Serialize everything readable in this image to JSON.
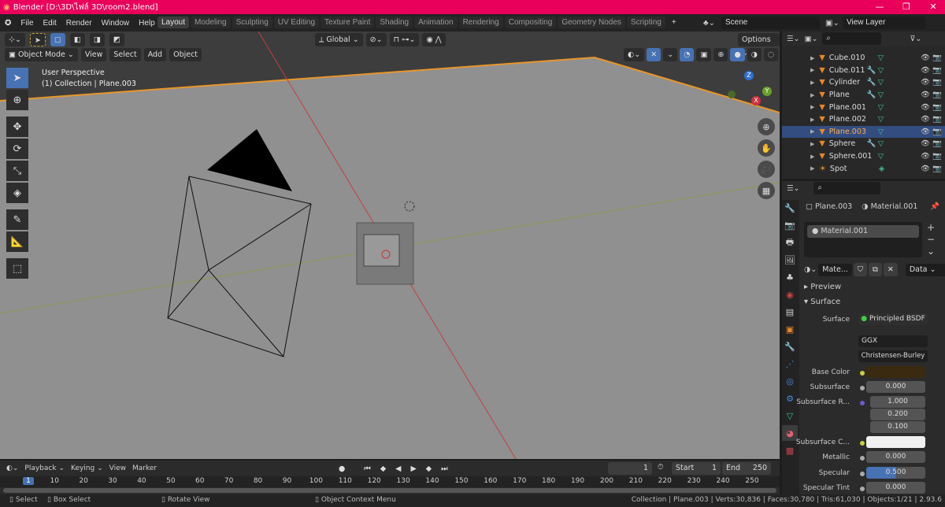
{
  "window": {
    "title": "Blender [D:\\3D\\ไฟล์ 3D\\room2.blend]",
    "minimize": "—",
    "maximize": "❐",
    "close": "✕"
  },
  "menu": [
    "File",
    "Edit",
    "Render",
    "Window",
    "Help"
  ],
  "workspaces": [
    "Layout",
    "Modeling",
    "Sculpting",
    "UV Editing",
    "Texture Paint",
    "Shading",
    "Animation",
    "Rendering",
    "Compositing",
    "Geometry Nodes",
    "Scripting"
  ],
  "add_workspace": "+",
  "scene": "Scene",
  "view_layer": "View Layer",
  "viewport": {
    "transform_orientation": "Global",
    "options": "Options",
    "mode": "Object Mode",
    "menus": [
      "View",
      "Select",
      "Add",
      "Object"
    ],
    "info_line1": "User Perspective",
    "info_line2": "(1) Collection | Plane.003",
    "gizmo": {
      "z": "Z",
      "y": "Y",
      "x": "X"
    }
  },
  "outliner": {
    "items": [
      {
        "name": "Cube.010",
        "icon": "mesh",
        "modifier": false
      },
      {
        "name": "Cube.011",
        "icon": "mesh",
        "modifier": true
      },
      {
        "name": "Cylinder",
        "icon": "mesh",
        "modifier": true
      },
      {
        "name": "Plane",
        "icon": "mesh",
        "modifier": true
      },
      {
        "name": "Plane.001",
        "icon": "mesh",
        "modifier": false
      },
      {
        "name": "Plane.002",
        "icon": "mesh",
        "modifier": false
      },
      {
        "name": "Plane.003",
        "icon": "mesh",
        "modifier": false,
        "selected": true
      },
      {
        "name": "Sphere",
        "icon": "mesh",
        "modifier": true
      },
      {
        "name": "Sphere.001",
        "icon": "mesh",
        "modifier": false
      },
      {
        "name": "Spot",
        "icon": "light",
        "modifier": false
      }
    ]
  },
  "properties": {
    "object": "Plane.003",
    "material": "Material.001",
    "slot": "Material.001",
    "mat_short": "Mate...",
    "link": "Data",
    "panels": {
      "preview": "Preview",
      "surface": "Surface"
    },
    "rows": {
      "surface_label": "Surface",
      "surface_value": "Principled BSDF",
      "distribution": "GGX",
      "subsurface_method": "Christensen-Burley",
      "base_color": "Base Color",
      "subsurface": "Subsurface",
      "subsurface_val": "0.000",
      "subsurface_radius": "Subsurface R...",
      "radius": [
        "1.000",
        "0.200",
        "0.100"
      ],
      "subsurface_color": "Subsurface C...",
      "metallic": "Metallic",
      "metallic_val": "0.000",
      "specular": "Specular",
      "specular_val": "0.500",
      "specular_fill": 0.5,
      "specular_tint": "Specular Tint",
      "specular_tint_val": "0.000"
    },
    "colors": {
      "base_color": "#3a2a10",
      "subsurface_color": "#f0f0f0"
    }
  },
  "timeline": {
    "menus": [
      "Playback",
      "Keying",
      "View",
      "Marker"
    ],
    "current_frame": "1",
    "start_label": "Start",
    "start": "1",
    "end_label": "End",
    "end": "250",
    "ticks": [
      "1",
      "10",
      "20",
      "30",
      "40",
      "50",
      "60",
      "70",
      "80",
      "90",
      "100",
      "110",
      "120",
      "130",
      "140",
      "150",
      "160",
      "170",
      "180",
      "190",
      "200",
      "210",
      "220",
      "230",
      "240",
      "250"
    ]
  },
  "status": {
    "select": "Select",
    "box_select": "Box Select",
    "rotate": "Rotate View",
    "context": "Object Context Menu",
    "stats": "Collection | Plane.003 | Verts:30,836 | Faces:30,780 | Tris:61,030 | Objects:1/21 | 2.93.6"
  }
}
